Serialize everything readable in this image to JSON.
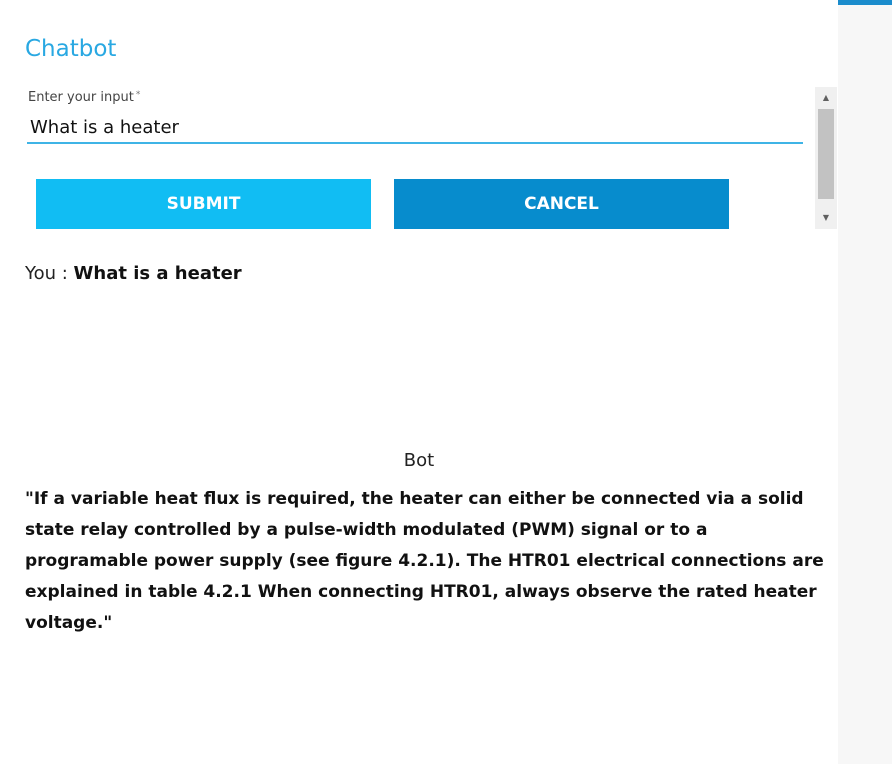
{
  "app": {
    "title": "Chatbot"
  },
  "input": {
    "label": "Enter your input",
    "required_mark": "*",
    "value": "What is a heater"
  },
  "buttons": {
    "submit_label": "SUBMIT",
    "cancel_label": "CANCEL"
  },
  "conversation": {
    "user_prefix": "You : ",
    "user_message": "What is a heater",
    "bot_label": "Bot",
    "bot_reply": "\"If a variable heat flux is required, the heater can either be connected via a solid state relay controlled by a pulse-width modulated (PWM) signal or to a programable power supply (see figure 4.2.1). The HTR01 electrical connections are explained in table 4.2.1 When connecting HTR01, always observe the rated heater voltage.\""
  },
  "icons": {
    "scroll_up": "scroll-up-arrow-icon",
    "scroll_down": "scroll-down-arrow-icon"
  },
  "colors": {
    "accent": "#29a8e2",
    "top_bar": "#1b8ccc",
    "submit_button": "#11bdf3",
    "cancel_button": "#078ccd",
    "input_underline": "#3fb4e6"
  }
}
